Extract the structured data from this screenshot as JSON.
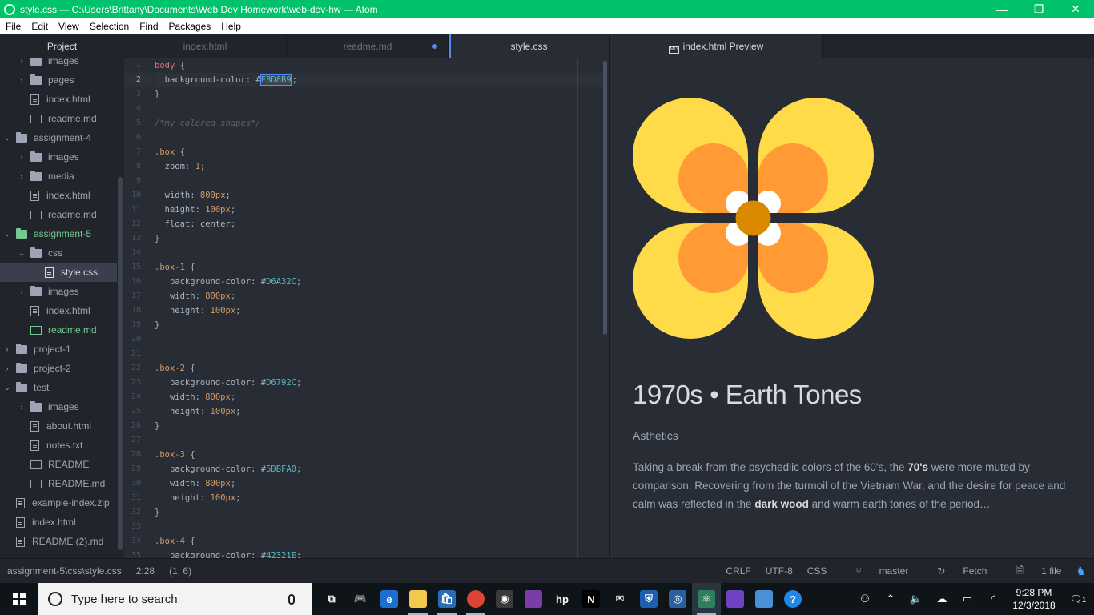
{
  "window": {
    "title": "style.css — C:\\Users\\Brittany\\Documents\\Web Dev Homework\\web-dev-hw — Atom",
    "minimize": "—",
    "restore": "❐",
    "close": "✕"
  },
  "menu": [
    "File",
    "Edit",
    "View",
    "Selection",
    "Find",
    "Packages",
    "Help"
  ],
  "tree": {
    "header": "Project",
    "items": [
      {
        "label": "images",
        "kind": "folder",
        "indent": 1,
        "expanded": false
      },
      {
        "label": "pages",
        "kind": "folder",
        "indent": 1,
        "expanded": false
      },
      {
        "label": "index.html",
        "kind": "file",
        "indent": 1
      },
      {
        "label": "readme.md",
        "kind": "md",
        "indent": 1
      },
      {
        "label": "assignment-4",
        "kind": "folder",
        "indent": 0,
        "expanded": true
      },
      {
        "label": "images",
        "kind": "folder",
        "indent": 1,
        "expanded": false
      },
      {
        "label": "media",
        "kind": "folder",
        "indent": 1,
        "expanded": false
      },
      {
        "label": "index.html",
        "kind": "file",
        "indent": 1
      },
      {
        "label": "readme.md",
        "kind": "md",
        "indent": 1
      },
      {
        "label": "assignment-5",
        "kind": "folder",
        "indent": 0,
        "expanded": true,
        "vcs": true
      },
      {
        "label": "css",
        "kind": "folder",
        "indent": 1,
        "expanded": true
      },
      {
        "label": "style.css",
        "kind": "file",
        "indent": 2,
        "selected": true
      },
      {
        "label": "images",
        "kind": "folder",
        "indent": 1,
        "expanded": false
      },
      {
        "label": "index.html",
        "kind": "file",
        "indent": 1
      },
      {
        "label": "readme.md",
        "kind": "md",
        "indent": 1,
        "vcs": true
      },
      {
        "label": "project-1",
        "kind": "folder",
        "indent": 0,
        "expanded": false
      },
      {
        "label": "project-2",
        "kind": "folder",
        "indent": 0,
        "expanded": false
      },
      {
        "label": "test",
        "kind": "folder",
        "indent": 0,
        "expanded": true
      },
      {
        "label": "images",
        "kind": "folder",
        "indent": 1,
        "expanded": false
      },
      {
        "label": "about.html",
        "kind": "file",
        "indent": 1
      },
      {
        "label": "notes.txt",
        "kind": "file",
        "indent": 1
      },
      {
        "label": "README",
        "kind": "md",
        "indent": 1
      },
      {
        "label": "README.md",
        "kind": "md",
        "indent": 1
      },
      {
        "label": "example-index.zip",
        "kind": "file",
        "indent": 0
      },
      {
        "label": "index.html",
        "kind": "file",
        "indent": 0
      },
      {
        "label": "README (2).md",
        "kind": "file",
        "indent": 0
      }
    ]
  },
  "tabs": [
    {
      "label": "index.html"
    },
    {
      "label": "readme.md",
      "modified": true
    },
    {
      "label": "style.css",
      "active": true
    },
    {
      "label": "index.html Preview",
      "active": true,
      "preview": true,
      "badge": "MD"
    }
  ],
  "editor": {
    "current_line": 2,
    "lines": [
      [
        [
          "body",
          "sel"
        ],
        [
          " {",
          ""
        ]
      ],
      [
        [
          "  background-color: #",
          "prop"
        ],
        [
          "E8D8B9",
          "selhex"
        ],
        [
          ";",
          "cursor"
        ]
      ],
      [
        [
          "}",
          ""
        ]
      ],
      [],
      [
        [
          "/*my colored shapes*/",
          "cmt"
        ]
      ],
      [],
      [
        [
          ".box",
          "cls"
        ],
        [
          " {",
          ""
        ]
      ],
      [
        [
          "  zoom: ",
          "prop"
        ],
        [
          "1",
          "num"
        ],
        [
          ";",
          ""
        ]
      ],
      [],
      [
        [
          "  width: ",
          "prop"
        ],
        [
          "800px",
          "num"
        ],
        [
          ";",
          ""
        ]
      ],
      [
        [
          "  height: ",
          "prop"
        ],
        [
          "100px",
          "num"
        ],
        [
          ";",
          ""
        ]
      ],
      [
        [
          "  float: center;",
          "prop"
        ]
      ],
      [
        [
          "}",
          ""
        ]
      ],
      [],
      [
        [
          ".box-1",
          "cls"
        ],
        [
          " {",
          ""
        ]
      ],
      [
        [
          "   background-color: #",
          "prop"
        ],
        [
          "D6A32C",
          "hex"
        ],
        [
          ";",
          ""
        ]
      ],
      [
        [
          "   width: ",
          "prop"
        ],
        [
          "800px",
          "num"
        ],
        [
          ";",
          ""
        ]
      ],
      [
        [
          "   height: ",
          "prop"
        ],
        [
          "100px",
          "num"
        ],
        [
          ";",
          ""
        ]
      ],
      [
        [
          "}",
          ""
        ]
      ],
      [],
      [],
      [
        [
          ".box-2",
          "cls"
        ],
        [
          " {",
          ""
        ]
      ],
      [
        [
          "   background-color: #",
          "prop"
        ],
        [
          "D6792C",
          "hex"
        ],
        [
          ";",
          ""
        ]
      ],
      [
        [
          "   width: ",
          "prop"
        ],
        [
          "800px",
          "num"
        ],
        [
          ";",
          ""
        ]
      ],
      [
        [
          "   height: ",
          "prop"
        ],
        [
          "100px",
          "num"
        ],
        [
          ";",
          ""
        ]
      ],
      [
        [
          "}",
          ""
        ]
      ],
      [],
      [
        [
          ".box-3",
          "cls"
        ],
        [
          " {",
          ""
        ]
      ],
      [
        [
          "   background-color: #",
          "prop"
        ],
        [
          "5DBFA0",
          "hex"
        ],
        [
          ";",
          ""
        ]
      ],
      [
        [
          "   width: ",
          "prop"
        ],
        [
          "800px",
          "num"
        ],
        [
          ";",
          ""
        ]
      ],
      [
        [
          "   height: ",
          "prop"
        ],
        [
          "100px",
          "num"
        ],
        [
          ";",
          ""
        ]
      ],
      [
        [
          "}",
          ""
        ]
      ],
      [],
      [
        [
          ".box-4",
          "cls"
        ],
        [
          " {",
          ""
        ]
      ],
      [
        [
          "   background-color: #",
          "prop"
        ],
        [
          "42321E",
          "hex"
        ],
        [
          ";",
          ""
        ]
      ]
    ]
  },
  "preview": {
    "title": "1970s • Earth Tones",
    "subtitle": "Asthetics",
    "body_parts": [
      [
        "Taking a break from the psychedlic colors of the 60's, the ",
        false
      ],
      [
        "70's",
        true
      ],
      [
        " were more muted by comparison. Recovering from the turmoil of the Vietnam War, and the desire for peace and calm was reflected in the ",
        false
      ],
      [
        "dark wood",
        true
      ],
      [
        " and warm earth tones of the period…",
        false
      ]
    ],
    "colors": {
      "petal_outer": "#ffdb4a",
      "petal_mid": "#ff9a35",
      "center": "#d98800",
      "inner": "#ffffff"
    }
  },
  "status": {
    "path": "assignment-5\\css\\style.css",
    "cursor": "2:28",
    "selection": "(1, 6)",
    "line_ending": "CRLF",
    "encoding": "UTF-8",
    "grammar": "CSS",
    "branch": "master",
    "fetch": "Fetch",
    "files": "1 file"
  },
  "taskbar": {
    "search_placeholder": "Type here to search",
    "time": "9:28 PM",
    "date": "12/3/2018",
    "notifications": "1",
    "apps": [
      {
        "name": "task-view-icon",
        "color": "#0f1418",
        "glyph": "⧉"
      },
      {
        "name": "game-controller-icon",
        "color": "#0f1418",
        "glyph": "🎮"
      },
      {
        "name": "edge-icon",
        "color": "#1b6fd1",
        "glyph": "e"
      },
      {
        "name": "file-explorer-icon",
        "color": "#f2c94c",
        "glyph": ""
      },
      {
        "name": "store-icon",
        "color": "#2a6db5",
        "glyph": "🛍"
      },
      {
        "name": "chrome-icon",
        "color": "#db4437",
        "glyph": ""
      },
      {
        "name": "media-player-icon",
        "color": "#3b3b3b",
        "glyph": "◉"
      },
      {
        "name": "photos-app-icon",
        "color": "#7a3da8",
        "glyph": ""
      },
      {
        "name": "hp-icon",
        "color": "#0f1418",
        "glyph": "hp"
      },
      {
        "name": "netflix-icon",
        "color": "#000000",
        "glyph": "N"
      },
      {
        "name": "mail-icon",
        "color": "#0f1418",
        "glyph": "✉"
      },
      {
        "name": "security-shield-icon",
        "color": "#1c5fb0",
        "glyph": "⛨"
      },
      {
        "name": "fiddler-icon",
        "color": "#2c5f9e",
        "glyph": "◎"
      },
      {
        "name": "atom-icon",
        "color": "#2f7f5f",
        "glyph": "⚛",
        "active": true
      },
      {
        "name": "github-desktop-icon",
        "color": "#6f42c1",
        "glyph": ""
      },
      {
        "name": "paint-app-icon",
        "color": "#4a90d9",
        "glyph": ""
      },
      {
        "name": "help-icon",
        "color": "#1e88e5",
        "glyph": "?"
      }
    ]
  }
}
